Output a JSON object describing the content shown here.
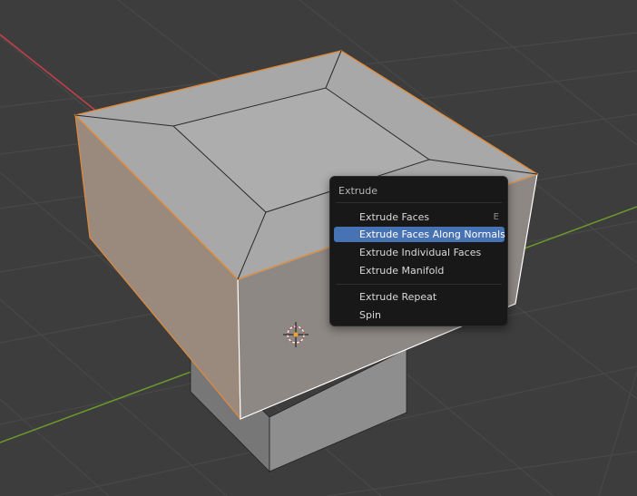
{
  "menu": {
    "title": "Extrude",
    "items": [
      {
        "label": "Extrude Faces",
        "shortcut": "E",
        "active": false
      },
      {
        "label": "Extrude Faces Along Normals",
        "shortcut": "",
        "active": true
      },
      {
        "label": "Extrude Individual Faces",
        "shortcut": "",
        "active": false
      },
      {
        "label": "Extrude Manifold",
        "shortcut": "",
        "active": false
      },
      {
        "label": "Extrude Repeat",
        "shortcut": "",
        "active": false
      },
      {
        "label": "Spin",
        "shortcut": "",
        "active": false
      }
    ]
  },
  "colors": {
    "viewport_background": "#3d3d3d",
    "grid_line": "#4a4a4a",
    "x_axis": "#c4404a",
    "y_axis": "#6a9a2c",
    "top_face": "#a8a8a8",
    "selected_side_face": "#9a8a7e",
    "front_face": "#8e8884",
    "selection_outline": "#e08a3a",
    "menu_background": "#181818",
    "menu_highlight": "#4772b3"
  },
  "icons": {
    "origin_marker": "object-origin-icon",
    "cursor": "3d-cursor-icon"
  }
}
